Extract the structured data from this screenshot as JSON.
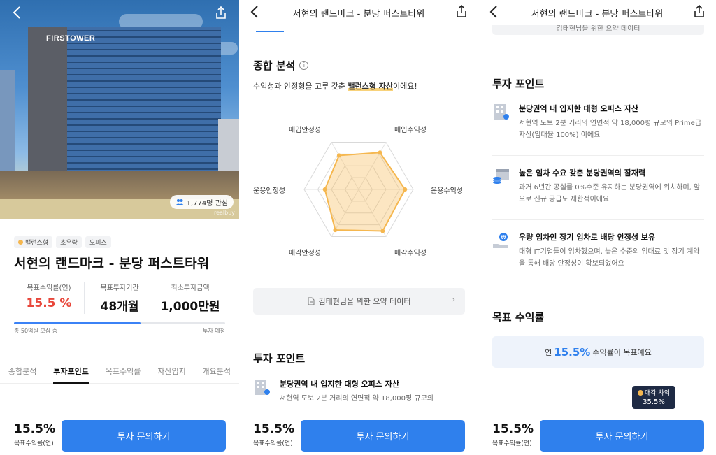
{
  "panel1": {
    "interest": "1,774명 관심",
    "watermark": "realbuy",
    "building_sign": "FIRSTOWER",
    "tags": [
      "밸런스형",
      "초우량",
      "오피스"
    ],
    "title": "서현의 랜드마크 - 분당 퍼스트타워",
    "stats": [
      {
        "label": "목표수익률(연)",
        "value": "15.5 %"
      },
      {
        "label": "목표투자기간",
        "value": "48개월"
      },
      {
        "label": "최소투자금액",
        "value": "1,000만원"
      }
    ],
    "progress_fraction": 0.6,
    "progress_left": "총 50억원 모집 중",
    "progress_right": "투자 예정",
    "tabs": [
      "종합분석",
      "투자포인트",
      "목표수익률",
      "자산입지",
      "개요분석"
    ],
    "active_tab": "투자포인트"
  },
  "header_title": "서현의 랜드마크 - 분당 퍼스트타워",
  "bottom": {
    "value": "15.5%",
    "label": "목표수익률(연)",
    "button": "투자 문의하기"
  },
  "panel2": {
    "section_title": "종합 분석",
    "desc_pre": "수익성과 안정형을 고루 갖춘 ",
    "desc_hl": "밸런스형 자산",
    "desc_post": "이에요!",
    "radar_labels": {
      "top_left": "매입안정성",
      "top_right": "매입수익성",
      "right": "운용수익성",
      "bottom_right": "매각수익성",
      "bottom_left": "매각안정성",
      "left": "운용안정성"
    },
    "radar_scores": [
      0.72,
      0.78,
      0.85,
      0.88,
      0.86,
      0.62
    ],
    "summary_button": "김태현님을 위한 요약 데이터",
    "points_title": "투자 포인트",
    "point1_title": "분당권역 내 입지한 대형 오피스 자산",
    "point1_desc": "서현역 도보 2분 거리의 연면적 약 18,000평 규모의"
  },
  "panel3": {
    "top_button": "김태현님을 위한 요약 데이터",
    "points_title": "투자 포인트",
    "points": [
      {
        "title": "분당권역 내 입지한 대형 오피스 자산",
        "desc": "서현역 도보 2분 거리의 연면적 약 18,000평 규모의 Prime급 자산(임대율 100%) 이에요"
      },
      {
        "title": "높은 임차 수요 갖춘 분당권역의 잠재력",
        "desc": "과거 6년간 공실률 0%수준 유지하는 분당권역에 위치하며, 앞으로 신규 공급도 제한적이에요"
      },
      {
        "title": "우량 임차인 장기 임차로 배당 안정성 보유",
        "desc": "대형 IT기업들이 임차했으며, 높은 수준의 임대료 및 장기 계약을 통해 배당 안정성이 확보되었어요"
      }
    ],
    "yield_title": "목표 수익률",
    "yield_pre": "연",
    "yield_value": "15.5%",
    "yield_post": "수익률이 목표예요",
    "tooltip_label": "매각 차익",
    "tooltip_value": "35.5%"
  },
  "colors": {
    "accent": "#2f80ed",
    "yield_red": "#e8473b",
    "radar_fill": "#f5b74f"
  }
}
